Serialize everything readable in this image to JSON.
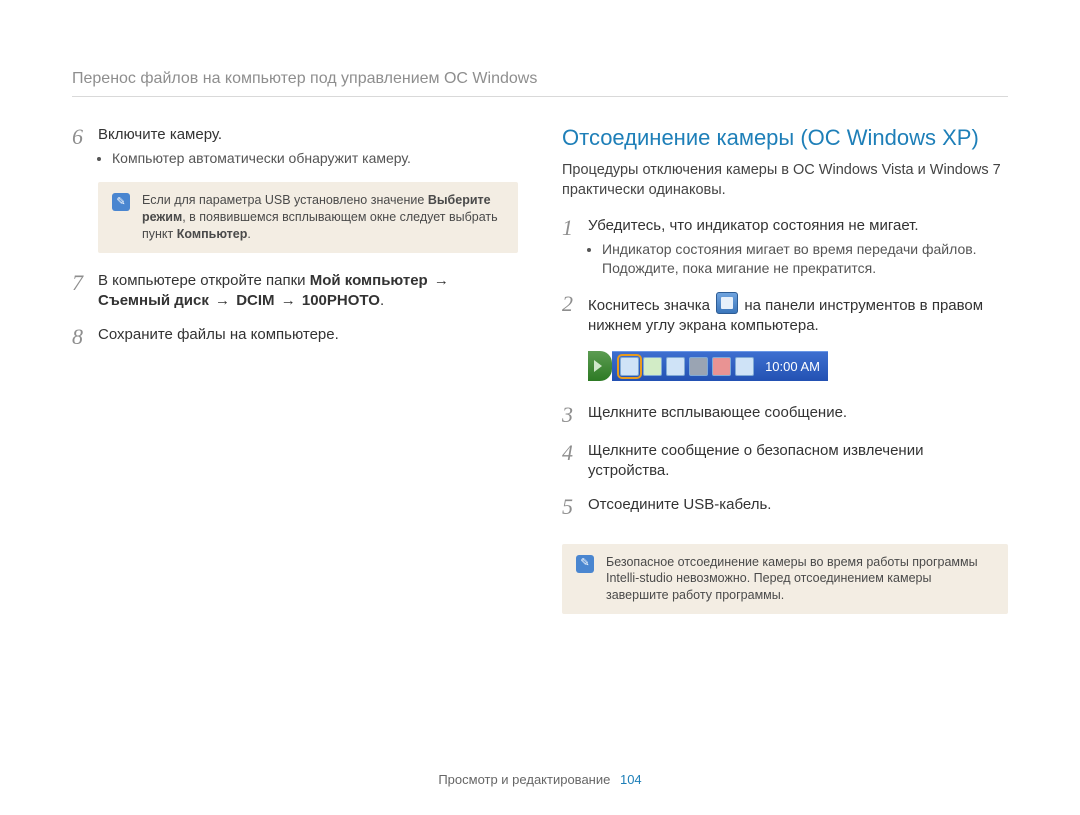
{
  "header": {
    "title": "Перенос файлов на компьютер под управлением ОС Windows"
  },
  "left": {
    "step6": {
      "num": "6",
      "title": "Включите камеру.",
      "bullet": "Компьютер автоматически обнаружит камеру."
    },
    "note1": {
      "pre": "Если для параметра USB установлено значение ",
      "b1": "Выберите режим",
      "mid": ", в появившемся всплывающем окне следует выбрать пункт ",
      "b2": "Компьютер",
      "post": "."
    },
    "step7": {
      "num": "7",
      "pre": "В компьютере откройте папки ",
      "p1": "Мой компьютер",
      "arr1": " → ",
      "p2": "Съемный диск",
      "arr2": " → ",
      "p3": "DCIM",
      "arr3": " → ",
      "p4": "100PHOTO",
      "post": "."
    },
    "step8": {
      "num": "8",
      "title": "Сохраните файлы на компьютере."
    }
  },
  "right": {
    "section_title": "Отсоединение камеры (ОС Windows XP)",
    "intro": "Процедуры отключения камеры в ОС Windows Vista и Windows 7 практически одинаковы.",
    "step1": {
      "num": "1",
      "title": "Убедитесь, что индикатор состояния не мигает.",
      "bullet": "Индикатор состояния мигает во время передачи файлов. Подождите, пока мигание не прекратится."
    },
    "step2": {
      "num": "2",
      "pre": "Коснитесь значка ",
      "post": " на панели инструментов в правом нижнем углу экрана компьютера."
    },
    "tray_time": "10:00 AM",
    "step3": {
      "num": "3",
      "title": "Щелкните всплывающее сообщение."
    },
    "step4": {
      "num": "4",
      "title": "Щелкните сообщение о безопасном извлечении устройства."
    },
    "step5": {
      "num": "5",
      "title": "Отсоедините USB-кабель."
    },
    "note2": "Безопасное отсоединение камеры во время работы программы Intelli-studio невозможно. Перед отсоединением камеры завершите работу программы."
  },
  "footer": {
    "section": "Просмотр и редактирование",
    "page": "104"
  }
}
